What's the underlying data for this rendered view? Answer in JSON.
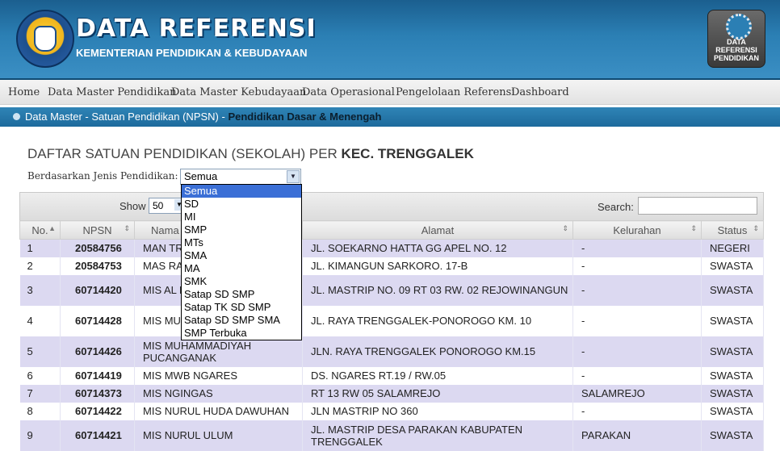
{
  "header": {
    "title": "DATA REFERENSI",
    "subtitle": "KEMENTERIAN PENDIDIKAN & KEBUDAYAAN",
    "badge_lines": [
      "DATA",
      "REFERENSI",
      "PENDIDIKAN"
    ],
    "logo_text": "TUT WURI HANDAYANI"
  },
  "nav": [
    "Home",
    "Data Master Pendidikan",
    "Data Master Kebudayaan",
    "Data Operasional",
    "Pengelolaan Referensi",
    "Dashboard"
  ],
  "breadcrumb": {
    "prefix": "Data Master - Satuan Pendidikan (NPSN) - ",
    "current": "Pendidikan Dasar & Menengah"
  },
  "page": {
    "title_prefix": "DAFTAR SATUAN PENDIDIKAN (SEKOLAH) PER ",
    "title_strong": "KEC. TRENGGALEK",
    "filter_label": "Berdasarkan Jenis Pendidikan:",
    "filter_value": "Semua"
  },
  "dropdown": [
    "Semua",
    "SD",
    "MI",
    "SMP",
    "MTs",
    "SMA",
    "MA",
    "SMK",
    "Satap SD SMP",
    "Satap TK SD SMP",
    "Satap SD SMP SMA",
    "SMP Terbuka"
  ],
  "toolbar": {
    "show_label": "Show",
    "length_value": "50",
    "search_label": "Search:"
  },
  "table": {
    "headers": [
      "No.",
      "NPSN",
      "Nama",
      "Alamat",
      "Kelurahan",
      "Status"
    ],
    "rows": [
      {
        "no": "1",
        "npsn": "20584756",
        "nama": "MAN TR",
        "alamat": "JL. SOEKARNO HATTA GG APEL NO. 12",
        "kel": "-",
        "status": "NEGERI"
      },
      {
        "no": "2",
        "npsn": "20584753",
        "nama": "MAS RA",
        "alamat": "JL. KIMANGUN SARKORO. 17-B",
        "kel": "-",
        "status": "SWASTA"
      },
      {
        "no": "3",
        "npsn": "60714420",
        "nama": "MIS AL REJOW",
        "alamat": "JL. MASTRIP NO. 09 RT 03 RW. 02 REJOWINANGUN",
        "kel": "-",
        "status": "SWASTA"
      },
      {
        "no": "4",
        "npsn": "60714428",
        "nama": "MIS MU DERMO",
        "alamat": "JL. RAYA TRENGGALEK-PONOROGO KM. 10",
        "kel": "-",
        "status": "SWASTA"
      },
      {
        "no": "5",
        "npsn": "60714426",
        "nama": "MIS MUHAMMADIYAH PUCANGANAK",
        "alamat": "JLN. RAYA TRENGGALEK PONOROGO KM.15",
        "kel": "-",
        "status": "SWASTA"
      },
      {
        "no": "6",
        "npsn": "60714419",
        "nama": "MIS MWB NGARES",
        "alamat": "DS. NGARES RT.19 / RW.05",
        "kel": "-",
        "status": "SWASTA"
      },
      {
        "no": "7",
        "npsn": "60714373",
        "nama": "MIS NGINGAS",
        "alamat": "RT 13 RW 05 SALAMREJO",
        "kel": "SALAMREJO",
        "status": "SWASTA"
      },
      {
        "no": "8",
        "npsn": "60714422",
        "nama": "MIS NURUL HUDA DAWUHAN",
        "alamat": "JLN MASTRIP NO 360",
        "kel": "-",
        "status": "SWASTA"
      },
      {
        "no": "9",
        "npsn": "60714421",
        "nama": "MIS NURUL ULUM",
        "alamat": "JL. MASTRIP DESA PARAKAN KABUPATEN TRENGGALEK",
        "kel": "PARAKAN",
        "status": "SWASTA"
      }
    ]
  }
}
